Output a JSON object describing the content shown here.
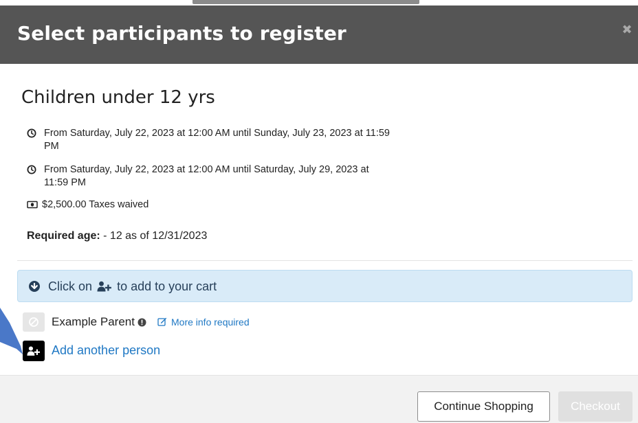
{
  "modal": {
    "title": "Select participants to register",
    "close_glyph": "✖"
  },
  "program": {
    "title": "Children under 12 yrs",
    "dates": [
      {
        "icon": "clock-icon",
        "text": "From Saturday, July 22, 2023 at 12:00 AM until Sunday, July 23, 2023 at 11:59 PM"
      },
      {
        "icon": "clock-icon",
        "text": "From Saturday, July 22, 2023 at 12:00 AM until Saturday, July 29, 2023 at 11:59 PM"
      }
    ],
    "price": {
      "icon": "money-icon",
      "text": "$2,500.00 Taxes waived"
    },
    "required_age": {
      "label": "Required age:",
      "value": "- 12 as of 12/31/2023"
    }
  },
  "alert": {
    "icon": "circle-arrow-down-icon",
    "text_before": "Click on",
    "inline_icon": "user-plus-icon",
    "text_after": "to add to your cart"
  },
  "participants": [
    {
      "name": "Example Parent",
      "status_icon": "ban-icon",
      "info_icon": "exclamation-circle-icon",
      "edit_icon": "edit-icon",
      "link_text": "More info required"
    }
  ],
  "add_person": {
    "icon": "user-plus-icon",
    "label": "Add another person"
  },
  "footer": {
    "continue_label": "Continue Shopping",
    "checkout_label": "Checkout"
  },
  "colors": {
    "header_bg": "#555555",
    "link": "#1f78c4",
    "alert_bg": "#d9ebf8",
    "annotation_arrow": "#4a78c8"
  }
}
